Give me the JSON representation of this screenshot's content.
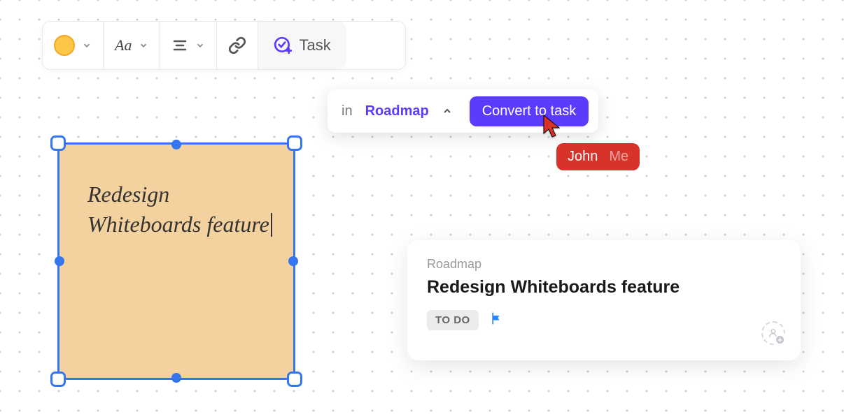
{
  "toolbar": {
    "color": "#fdc646",
    "font_label": "Aa",
    "task_label": "Task"
  },
  "picker": {
    "in_label": "in",
    "list_name": "Roadmap",
    "convert_label": "Convert to task"
  },
  "collab": {
    "user_name": "John",
    "me_label": "Me"
  },
  "note": {
    "text": "Redesign Whiteboards feature"
  },
  "card": {
    "breadcrumb": "Roadmap",
    "title": "Redesign Whiteboards feature",
    "status": "TO DO"
  }
}
